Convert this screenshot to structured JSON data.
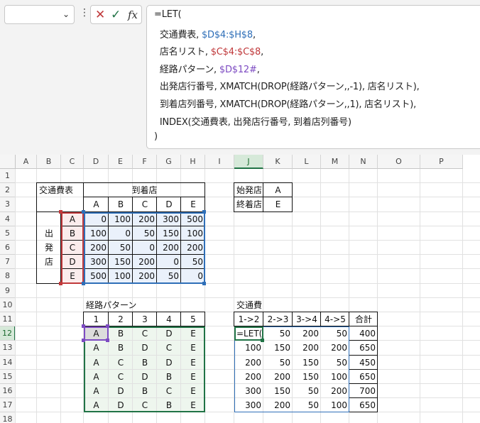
{
  "name_box": {
    "value": ""
  },
  "fx_buttons": {
    "cancel": "✕",
    "enter": "✓",
    "fx": "fx"
  },
  "formula": [
    [
      {
        "t": "=LET(",
        "c": "#222"
      }
    ],
    [
      {
        "t": "  交通費表, ",
        "c": "#222"
      },
      {
        "t": "$D$4:$H$8",
        "c": "#2f6fb8"
      },
      {
        "t": ",",
        "c": "#222"
      }
    ],
    [
      {
        "t": "  店名リスト, ",
        "c": "#222"
      },
      {
        "t": "$C$4:$C$8",
        "c": "#c0393b"
      },
      {
        "t": ",",
        "c": "#222"
      }
    ],
    [
      {
        "t": "  経路パターン, ",
        "c": "#222"
      },
      {
        "t": "$D$12#",
        "c": "#7d4bc2"
      },
      {
        "t": ",",
        "c": "#222"
      }
    ],
    [
      {
        "t": "  出発店行番号, XMATCH(DROP(経路パターン,,-1), 店名リスト),",
        "c": "#222"
      }
    ],
    [
      {
        "t": "  到着店列番号, XMATCH(DROP(経路パターン,,1), 店名リスト),",
        "c": "#222"
      }
    ],
    [
      {
        "t": "  INDEX(交通費表, 出発店行番号, 到着店列番号)",
        "c": "#222"
      }
    ],
    [
      {
        "t": ")",
        "c": "#222"
      }
    ]
  ],
  "columns": [
    "A",
    "B",
    "C",
    "D",
    "E",
    "F",
    "G",
    "H",
    "I",
    "J",
    "K",
    "L",
    "M",
    "N",
    "O",
    "P"
  ],
  "rows": [
    "1",
    "2",
    "3",
    "4",
    "5",
    "6",
    "7",
    "8",
    "9",
    "10",
    "11",
    "12",
    "13",
    "14",
    "15",
    "16",
    "17",
    "18"
  ],
  "selected_cell": {
    "col": "J",
    "row": "12"
  },
  "cells": {
    "B2": "交通費表",
    "D2": "到着店",
    "D3": "A",
    "E3": "B",
    "F3": "C",
    "G3": "D",
    "H3": "E",
    "B5": "出",
    "B6": "発",
    "B7": "店",
    "C4": "A",
    "C5": "B",
    "C6": "C",
    "C7": "D",
    "C8": "E",
    "D4": "0",
    "E4": "100",
    "F4": "200",
    "G4": "300",
    "H4": "500",
    "D5": "100",
    "E5": "0",
    "F5": "50",
    "G5": "150",
    "H5": "100",
    "D6": "200",
    "E6": "50",
    "F6": "0",
    "G6": "200",
    "H6": "200",
    "D7": "300",
    "E7": "150",
    "F7": "200",
    "G7": "0",
    "H7": "50",
    "D8": "500",
    "E8": "100",
    "F8": "200",
    "G8": "50",
    "H8": "0",
    "J2": "始発店",
    "K2": "A",
    "J3": "終着店",
    "K3": "E",
    "D10": "経路パターン",
    "D11": "1",
    "E11": "2",
    "F11": "3",
    "G11": "4",
    "H11": "5",
    "D12": "A",
    "E12": "B",
    "F12": "C",
    "G12": "D",
    "H12": "E",
    "D13": "A",
    "E13": "B",
    "F13": "D",
    "G13": "C",
    "H13": "E",
    "D14": "A",
    "E14": "C",
    "F14": "B",
    "G14": "D",
    "H14": "E",
    "D15": "A",
    "E15": "C",
    "F15": "D",
    "G15": "B",
    "H15": "E",
    "D16": "A",
    "E16": "D",
    "F16": "B",
    "G16": "C",
    "H16": "E",
    "D17": "A",
    "E17": "D",
    "F17": "C",
    "G17": "B",
    "H17": "E",
    "J10": "交通費",
    "J11": "1->2",
    "K11": "2->3",
    "L11": "3->4",
    "M11": "4->5",
    "N11": "合計",
    "J12": "=LET(",
    "K12": "50",
    "L12": "200",
    "M12": "50",
    "N12": "400",
    "J13": "100",
    "K13": "150",
    "L13": "200",
    "M13": "200",
    "N13": "650",
    "J14": "200",
    "K14": "50",
    "L14": "150",
    "M14": "50",
    "N14": "450",
    "J15": "200",
    "K15": "200",
    "L15": "150",
    "M15": "100",
    "N15": "650",
    "J16": "300",
    "K16": "150",
    "L16": "50",
    "M16": "200",
    "N16": "700",
    "J17": "300",
    "K17": "200",
    "L17": "50",
    "M17": "100",
    "N17": "650"
  },
  "colors": {
    "fee_range": "#2f6fb8",
    "fee_fill": "#eaf1fb",
    "store_range": "#c0393b",
    "store_fill": "#fbecec",
    "pattern_range": "#7d4bc2",
    "pattern_fill": "#eef6ee",
    "pattern_border": "#217346",
    "cost_border": "#2f6fb8",
    "select": "#217346"
  }
}
